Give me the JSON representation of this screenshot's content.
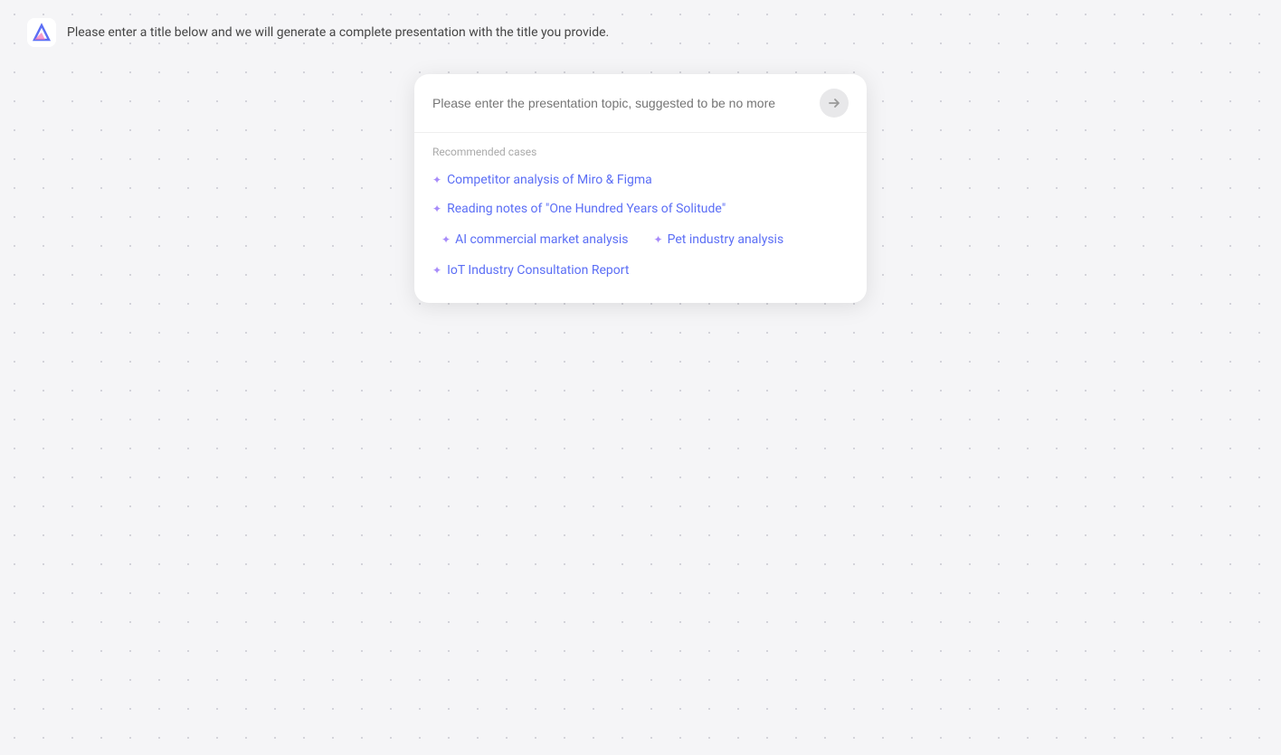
{
  "topbar": {
    "message": "Please enter a title below and we will generate a complete presentation with the title you provide."
  },
  "card": {
    "input": {
      "placeholder": "Please enter the presentation topic, suggested to be no more",
      "value": ""
    },
    "recommended_label": "Recommended cases",
    "cases": [
      {
        "id": "case-1",
        "label": "Competitor analysis of Miro & Figma",
        "inline": false
      },
      {
        "id": "case-2",
        "label": "Reading notes of \"One Hundred Years of Solitude\"",
        "inline": false
      }
    ],
    "inline_cases": [
      {
        "id": "case-3",
        "label": "AI commercial market analysis"
      },
      {
        "id": "case-4",
        "label": "Pet industry analysis"
      }
    ],
    "bottom_cases": [
      {
        "id": "case-5",
        "label": "IoT Industry Consultation Report"
      }
    ]
  },
  "icons": {
    "sparkle": "✦",
    "send_arrow": "→"
  }
}
